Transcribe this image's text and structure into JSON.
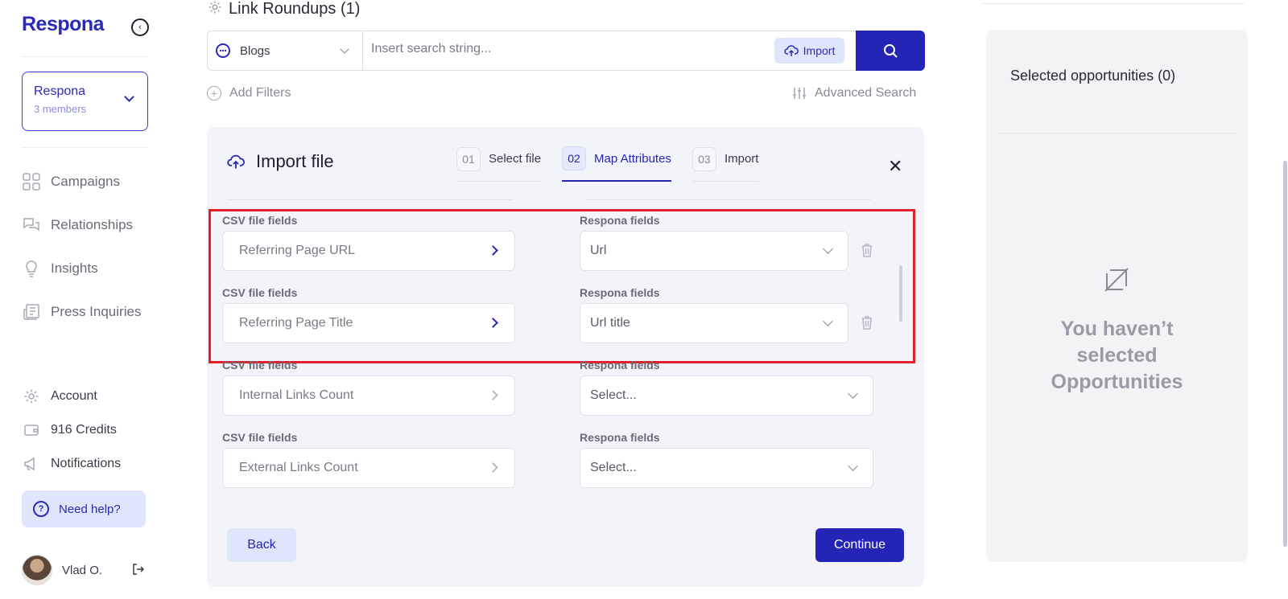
{
  "brand": {
    "logo": "Respona",
    "accent": "#2424b6",
    "highlight": "#e3202a"
  },
  "workspace": {
    "name": "Respona",
    "members": "3 members"
  },
  "nav": [
    {
      "label": "Campaigns",
      "icon": "grid-icon"
    },
    {
      "label": "Relationships",
      "icon": "chat-bubbles-icon"
    },
    {
      "label": "Insights",
      "icon": "lightbulb-icon"
    },
    {
      "label": "Press Inquiries",
      "icon": "newspaper-icon"
    }
  ],
  "bottom_nav": {
    "account": "Account",
    "credits": "916 Credits",
    "notifications": "Notifications",
    "help": "Need help?"
  },
  "user": {
    "name": "Vlad O."
  },
  "header": {
    "title": "Link Roundups (1)"
  },
  "search": {
    "source": "Blogs",
    "placeholder": "Insert search string...",
    "import_label": "Import",
    "add_filters": "Add Filters",
    "advanced_search": "Advanced Search"
  },
  "import_panel": {
    "title": "Import file",
    "steps": [
      {
        "num": "01",
        "label": "Select file"
      },
      {
        "num": "02",
        "label": "Map Attributes"
      },
      {
        "num": "03",
        "label": "Import"
      }
    ],
    "csv_label": "CSV file fields",
    "respona_label": "Respona fields",
    "mappings": [
      {
        "csv": "Referring Page URL",
        "respona": "Url"
      },
      {
        "csv": "Referring Page Title",
        "respona": "Url title"
      },
      {
        "csv": "Internal Links Count",
        "respona": "Select..."
      },
      {
        "csv": "External Links Count",
        "respona": "Select..."
      }
    ],
    "back": "Back",
    "continue": "Continue"
  },
  "selected": {
    "title": "Selected opportunities (0)",
    "empty_line1": "You haven’t",
    "empty_line2": "selected",
    "empty_line3": "Opportunities"
  }
}
